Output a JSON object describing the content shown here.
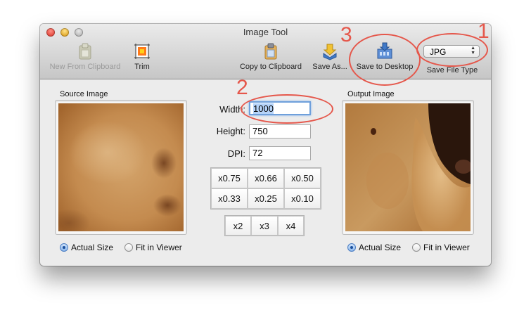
{
  "window": {
    "title": "Image Tool"
  },
  "toolbar": {
    "new_from_clipboard": "New From Clipboard",
    "trim": "Trim",
    "copy_to_clipboard": "Copy to Clipboard",
    "save_as": "Save As...",
    "save_to_desktop": "Save to Desktop",
    "save_file_type": "Save File Type",
    "file_type_value": "JPG"
  },
  "source": {
    "label": "Source Image"
  },
  "output": {
    "label": "Output Image"
  },
  "fields": {
    "width_label": "Width:",
    "width_value": "1000",
    "height_label": "Height:",
    "height_value": "750",
    "dpi_label": "DPI:",
    "dpi_value": "72"
  },
  "scales": {
    "row1": [
      "x0.75",
      "x0.66",
      "x0.50"
    ],
    "row2": [
      "x0.33",
      "x0.25",
      "x0.10"
    ],
    "row3": [
      "x2",
      "x3",
      "x4"
    ]
  },
  "view_options": {
    "actual_size": "Actual Size",
    "fit_in_viewer": "Fit in Viewer",
    "source_selected": "actual_size",
    "output_selected": "actual_size"
  },
  "annotations": [
    "1",
    "2",
    "3"
  ],
  "colors": {
    "annotation": "#e5574b",
    "focus": "#6fa0db"
  }
}
